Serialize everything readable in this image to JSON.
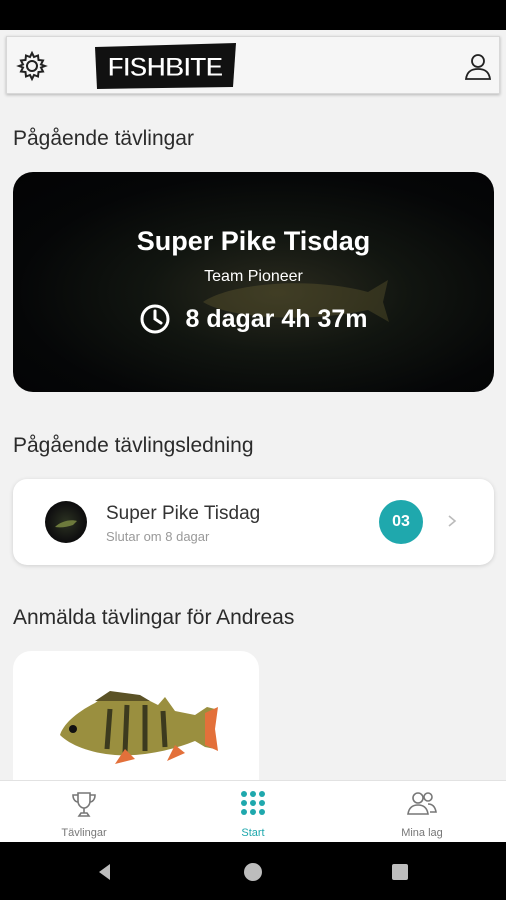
{
  "header": {
    "logo_text": "FISHBITE",
    "settings_icon": "gear-icon",
    "profile_icon": "user-icon"
  },
  "ongoing": {
    "section_title": "Pågående tävlingar",
    "competition_name": "Super Pike Tisdag",
    "team": "Team Pioneer",
    "countdown": "8 dagar 4h 37m",
    "countdown_icon": "clock-icon"
  },
  "leaderboard": {
    "section_title": "Pågående tävlingsledning",
    "name": "Super Pike Tisdag",
    "ends": "Slutar om 8 dagar",
    "position": "03",
    "badge_color": "#1fa8ad"
  },
  "registered": {
    "section_title": "Anmälda tävlingar för Andreas"
  },
  "nav": {
    "items": [
      {
        "label": "Tävlingar",
        "icon": "trophy-icon",
        "active": false
      },
      {
        "label": "Start",
        "icon": "grid-icon",
        "active": true
      },
      {
        "label": "Mina lag",
        "icon": "people-icon",
        "active": false
      }
    ],
    "active_color": "#1fa8ad"
  }
}
